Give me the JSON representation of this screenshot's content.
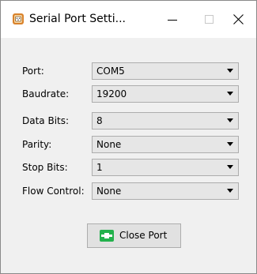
{
  "window": {
    "title": "Serial Port Setti...",
    "icon": "serial-port-chip-icon",
    "controls": {
      "minimize_icon": "minimize-icon",
      "maximize_icon": "maximize-icon",
      "close_icon": "close-icon"
    }
  },
  "settings": [
    {
      "label": "Port:",
      "value": "COM5"
    },
    {
      "label": "Baudrate:",
      "value": "19200"
    },
    {
      "label": "Data Bits:",
      "value": "8"
    },
    {
      "label": "Parity:",
      "value": "None"
    },
    {
      "label": "Stop Bits:",
      "value": "1"
    },
    {
      "label": "Flow Control:",
      "value": "None"
    }
  ],
  "action": {
    "label": "Close Port",
    "icon": "plug-connected-icon",
    "icon_color": "#22b14c"
  },
  "colors": {
    "window_bg": "#f0f0f0",
    "titlebar_bg": "#ffffff",
    "accent_green": "#22b14c",
    "chip_orange": "#d9822b"
  }
}
